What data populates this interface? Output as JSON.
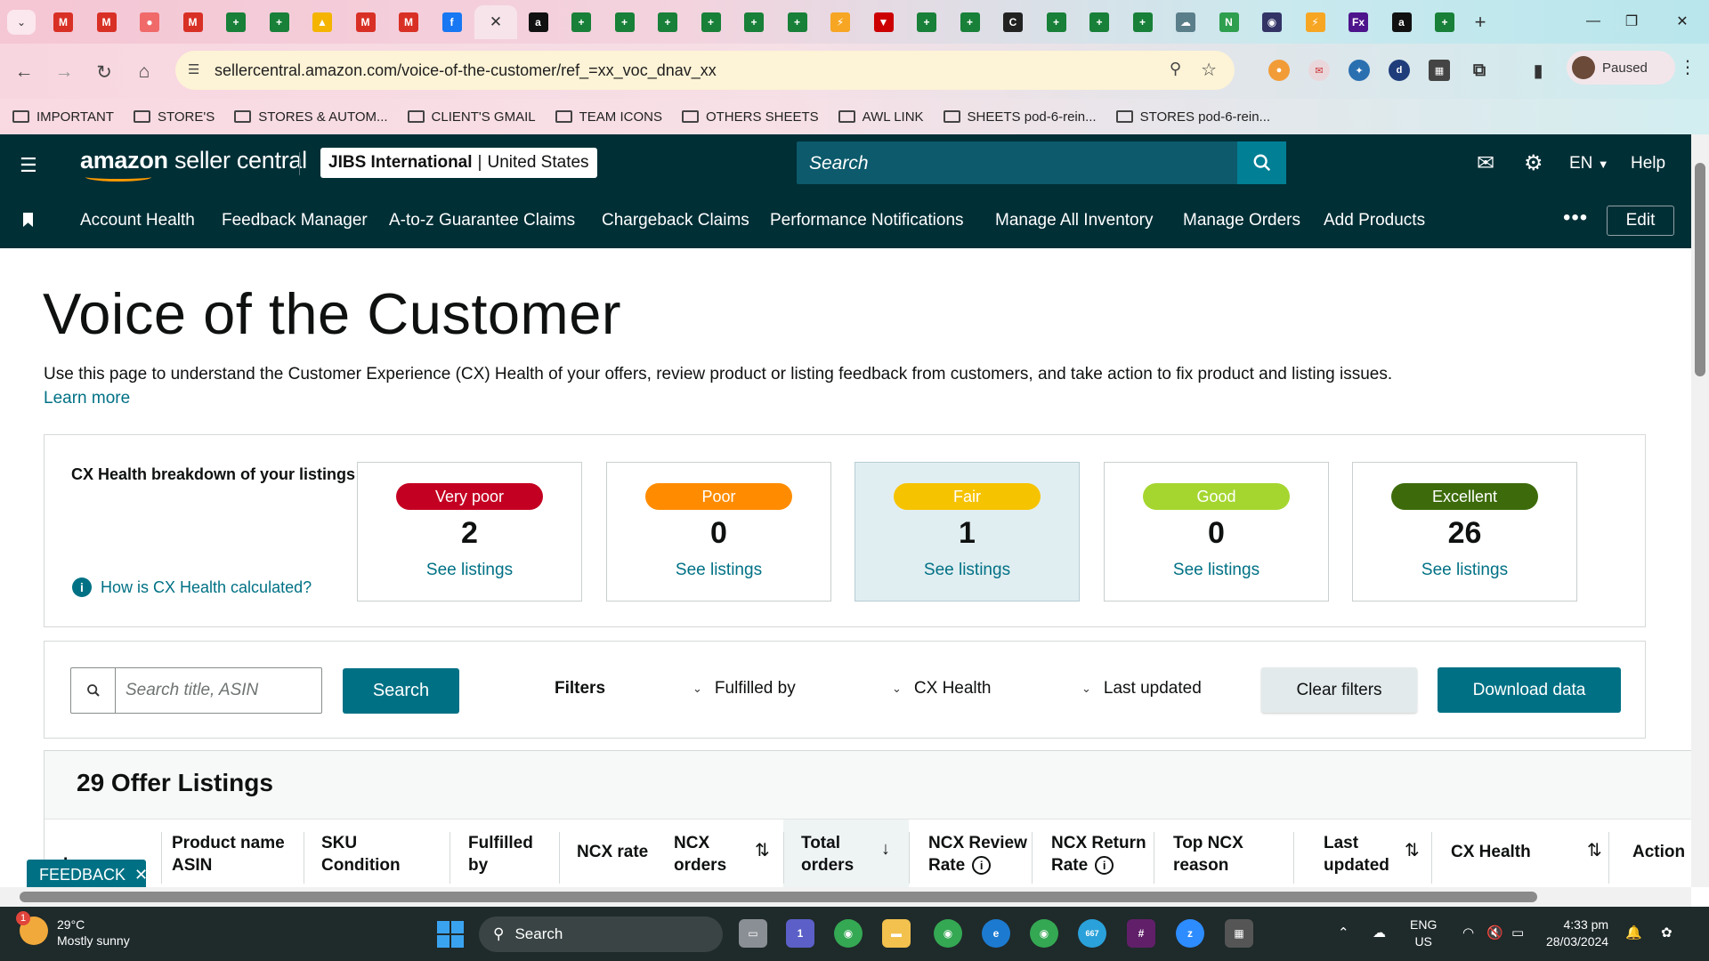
{
  "browser": {
    "tabs": [
      {
        "icon": "gmail-icon",
        "glyph": "M",
        "color": "#d93025"
      },
      {
        "icon": "gmail-icon",
        "glyph": "M",
        "color": "#d93025"
      },
      {
        "icon": "asana-icon",
        "glyph": "●",
        "color": "#f06a6a"
      },
      {
        "icon": "gmail-icon",
        "glyph": "M",
        "color": "#d93025"
      },
      {
        "icon": "sheets-icon",
        "glyph": "+",
        "color": "#188038"
      },
      {
        "icon": "sheets-icon",
        "glyph": "+",
        "color": "#188038"
      },
      {
        "icon": "drive-icon",
        "glyph": "▲",
        "color": "#f4b400"
      },
      {
        "icon": "gmail-icon",
        "glyph": "M",
        "color": "#d93025"
      },
      {
        "icon": "gmail-icon",
        "glyph": "M",
        "color": "#d93025"
      },
      {
        "icon": "facebook-icon",
        "glyph": "f",
        "color": "#1877f2"
      },
      {
        "icon": "close-icon",
        "glyph": "✕",
        "color": "#f7e4ea",
        "active": true
      },
      {
        "icon": "amazon-icon",
        "glyph": "a",
        "color": "#111111"
      },
      {
        "icon": "sheets-icon",
        "glyph": "+",
        "color": "#188038"
      },
      {
        "icon": "sheets-icon",
        "glyph": "+",
        "color": "#188038"
      },
      {
        "icon": "sheets-icon",
        "glyph": "+",
        "color": "#188038"
      },
      {
        "icon": "sheets-icon",
        "glyph": "+",
        "color": "#188038"
      },
      {
        "icon": "sheets-icon",
        "glyph": "+",
        "color": "#188038"
      },
      {
        "icon": "sheets-icon",
        "glyph": "+",
        "color": "#188038"
      },
      {
        "icon": "stripe-icon",
        "glyph": "⚡",
        "color": "#f6a623"
      },
      {
        "icon": "target-icon",
        "glyph": "▼",
        "color": "#cc0000"
      },
      {
        "icon": "sheets-icon",
        "glyph": "+",
        "color": "#188038"
      },
      {
        "icon": "sheets-icon",
        "glyph": "+",
        "color": "#188038"
      },
      {
        "icon": "c-icon",
        "glyph": "C",
        "color": "#222222"
      },
      {
        "icon": "sheets-icon",
        "glyph": "+",
        "color": "#188038"
      },
      {
        "icon": "sheets-icon",
        "glyph": "+",
        "color": "#188038"
      },
      {
        "icon": "sheets-icon",
        "glyph": "+",
        "color": "#188038"
      },
      {
        "icon": "cloud-icon",
        "glyph": "☁",
        "color": "#5b7f8a"
      },
      {
        "icon": "n-icon",
        "glyph": "N",
        "color": "#2e9e4f"
      },
      {
        "icon": "usps-icon",
        "glyph": "◉",
        "color": "#333366"
      },
      {
        "icon": "stripe-icon",
        "glyph": "⚡",
        "color": "#f6a623"
      },
      {
        "icon": "fedex-icon",
        "glyph": "Fx",
        "color": "#4d148c"
      },
      {
        "icon": "amazon-icon",
        "glyph": "a",
        "color": "#111111"
      },
      {
        "icon": "sheets-icon",
        "glyph": "+",
        "color": "#188038"
      }
    ],
    "url": "sellercentral.amazon.com/voice-of-the-customer/ref_=xx_voc_dnav_xx",
    "profile_status": "Paused",
    "bookmarks": [
      "IMPORTANT",
      "STORE'S",
      "STORES & AUTOM...",
      "CLIENT'S GMAIL",
      "TEAM ICONS",
      "OTHERS SHEETS",
      "AWL LINK",
      "SHEETS pod-6-rein...",
      "STORES pod-6-rein..."
    ]
  },
  "header": {
    "logo_brand": "amazon",
    "logo_suffix": "seller central",
    "account_name": "JIBS International",
    "marketplace": "United States",
    "search_placeholder": "Search",
    "language": "EN",
    "help": "Help"
  },
  "nav": {
    "items": [
      "Account Health",
      "Feedback Manager",
      "A-to-z Guarantee Claims",
      "Chargeback Claims",
      "Performance Notifications",
      "Manage All Inventory",
      "Manage Orders",
      "Add Products"
    ],
    "more": "•••",
    "edit": "Edit"
  },
  "page": {
    "title": "Voice of the Customer",
    "description": "Use this page to understand the Customer Experience (CX) Health of your offers, review product or listing feedback from customers, and take action to fix product and listing issues.",
    "learn_more": "Learn more"
  },
  "cx_health": {
    "heading": "CX Health breakdown of your listings",
    "how_link": "How is CX Health calculated?",
    "cards": [
      {
        "label": "Very poor",
        "count": "2",
        "link": "See listings",
        "color": "#c40022"
      },
      {
        "label": "Poor",
        "count": "0",
        "link": "See listings",
        "color": "#ff8c00"
      },
      {
        "label": "Fair",
        "count": "1",
        "link": "See listings",
        "color": "#f6c300",
        "selected": true
      },
      {
        "label": "Good",
        "count": "0",
        "link": "See listings",
        "color": "#a5d630"
      },
      {
        "label": "Excellent",
        "count": "26",
        "link": "See listings",
        "color": "#3d6b0b"
      }
    ]
  },
  "filters": {
    "search_placeholder": "Search title, ASIN",
    "search_button": "Search",
    "label": "Filters",
    "dropdowns": [
      "Fulfilled by",
      "CX Health",
      "Last updated"
    ],
    "clear": "Clear filters",
    "download": "Download data"
  },
  "table": {
    "title": "29 Offer Listings",
    "columns": [
      {
        "l1": "Image",
        "l2": ""
      },
      {
        "l1": "Product name",
        "l2": "ASIN"
      },
      {
        "l1": "SKU",
        "l2": "Condition"
      },
      {
        "l1": "Fulfilled",
        "l2": "by"
      },
      {
        "l1": "NCX rate",
        "l2": ""
      },
      {
        "l1": "NCX",
        "l2": "orders"
      },
      {
        "l1": "Total",
        "l2": "orders"
      },
      {
        "l1": "NCX Review",
        "l2": "Rate"
      },
      {
        "l1": "NCX Return",
        "l2": "Rate"
      },
      {
        "l1": "Top NCX",
        "l2": "reason"
      },
      {
        "l1": "Last",
        "l2": "updated"
      },
      {
        "l1": "CX Health",
        "l2": ""
      },
      {
        "l1": "Action",
        "l2": ""
      }
    ]
  },
  "feedback_tab": "FEEDBACK",
  "taskbar": {
    "temperature": "29°C",
    "weather": "Mostly sunny",
    "weather_badge": "1",
    "search": "Search",
    "language_line1": "ENG",
    "language_line2": "US",
    "time": "4:33 pm",
    "date": "28/03/2024",
    "teams_badge": "1",
    "telegram_badge": "667"
  }
}
